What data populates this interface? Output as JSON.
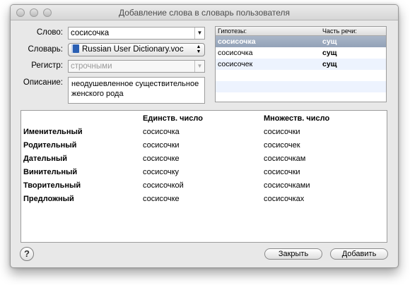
{
  "window": {
    "title": "Добавление слова в словарь пользователя"
  },
  "form": {
    "word_label": "Слово:",
    "word_value": "сосисочка",
    "dictionary_label": "Словарь:",
    "dictionary_value": "Russian User Dictionary.voc",
    "case_label": "Регистр:",
    "case_value": "строчными",
    "description_label": "Описание:",
    "description_value": "неодушевленное существительное женского рода"
  },
  "hypotheses": {
    "col_word": "Гипотезы:",
    "col_pos": "Часть речи:",
    "rows": [
      {
        "word": "сосисочка",
        "pos": "сущ"
      },
      {
        "word": "сосисочка",
        "pos": "сущ"
      },
      {
        "word": "сосисочек",
        "pos": "сущ"
      }
    ]
  },
  "forms": {
    "col_singular": "Единств. число",
    "col_plural": "Множеств. число",
    "rows": [
      {
        "case": "Именительный",
        "singular": "сосисочка",
        "plural": "сосисочки"
      },
      {
        "case": "Родительный",
        "singular": "сосисочки",
        "plural": "сосисочек"
      },
      {
        "case": "Дательный",
        "singular": "сосисочке",
        "plural": "сосисочкам"
      },
      {
        "case": "Винительный",
        "singular": "сосисочку",
        "plural": "сосисочки"
      },
      {
        "case": "Творительный",
        "singular": "сосисочкой",
        "plural": "сосисочками"
      },
      {
        "case": "Предложный",
        "singular": "сосисочке",
        "plural": "сосисочках"
      }
    ]
  },
  "buttons": {
    "help": "?",
    "close": "Закрыть",
    "add": "Добавить"
  },
  "colors": {
    "selection": "#9aa8bc",
    "alt_row": "#edf3fe",
    "window_bg": "#e8e8e8"
  }
}
